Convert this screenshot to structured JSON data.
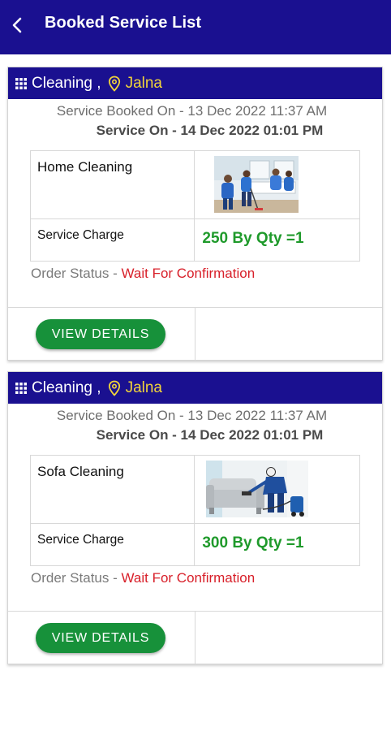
{
  "appbar": {
    "title": "Booked Service List",
    "back_icon": "back-arrow-icon"
  },
  "bookings": [
    {
      "category": "Cleaning ,",
      "city": "Jalna",
      "booked_on": "Service Booked On - 13 Dec 2022 11:37 AM",
      "service_on": "Service On - 14 Dec 2022 01:01 PM",
      "service_name": "Home Cleaning",
      "charge_label": "Service Charge",
      "charge_value": "250 By Qty =1",
      "status_label": "Order Status - ",
      "status_value": "Wait For Confirmation",
      "button_label": "VIEW DETAILS"
    },
    {
      "category": "Cleaning ,",
      "city": "Jalna",
      "booked_on": "Service Booked On - 13 Dec 2022 11:37 AM",
      "service_on": "Service On - 14 Dec 2022 01:01 PM",
      "service_name": "Sofa Cleaning",
      "charge_label": "Service Charge",
      "charge_value": "300 By Qty =1",
      "status_label": "Order Status - ",
      "status_value": "Wait For Confirmation",
      "button_label": "VIEW DETAILS"
    }
  ],
  "colors": {
    "header_bg": "#1a1090",
    "city_text": "#f2d43a",
    "charge_text": "#1f9a2b",
    "status_text": "#d8202a",
    "button_bg": "#17913a"
  }
}
